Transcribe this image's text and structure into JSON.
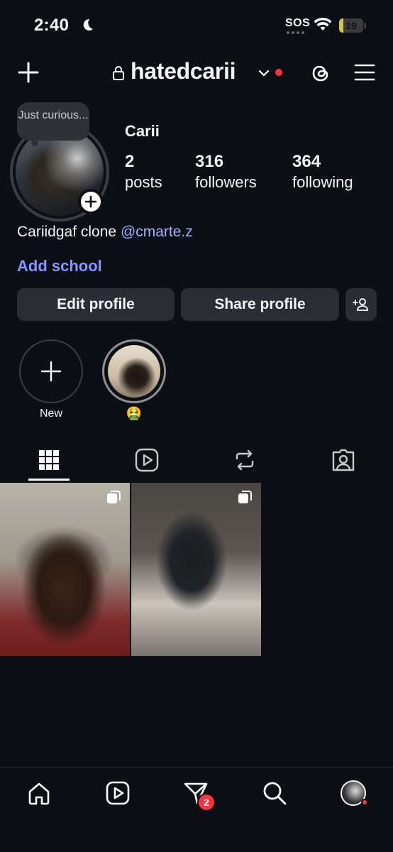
{
  "status_bar": {
    "time": "2:40",
    "sos": "SOS",
    "battery": "19",
    "battery_level": 0.19
  },
  "header": {
    "username": "hatedcarii"
  },
  "profile": {
    "note": "Just curious...",
    "display_name": "Carii",
    "stats": [
      {
        "value": "2",
        "label": "posts"
      },
      {
        "value": "316",
        "label": "followers"
      },
      {
        "value": "364",
        "label": "following"
      }
    ],
    "bio_text": "Cariidgaf clone",
    "bio_mention": "@cmarte.z",
    "add_school": "Add school"
  },
  "buttons": {
    "edit": "Edit profile",
    "share": "Share profile"
  },
  "highlights": [
    {
      "label": "New"
    },
    {
      "label": "🤮"
    }
  ],
  "tabs": [
    "grid-icon",
    "reels-icon",
    "reposts-icon",
    "tagged-icon"
  ],
  "bottom_nav": {
    "notification_badge": "2"
  },
  "colors": {
    "background": "#0c0f14",
    "link": "#8296ff",
    "badge": "#ff3040"
  }
}
